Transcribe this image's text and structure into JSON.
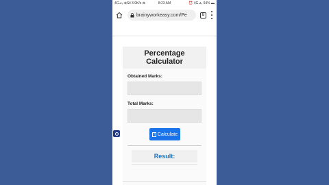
{
  "status_bar": {
    "left": "4G⊿ᵢₗ ⊗Sil 3.9K/s ⋒",
    "time": "8:23 AM",
    "right": "⏰ 4G⊿ᵢₗ 94% ▬"
  },
  "browser": {
    "url": "brainyworkeasy.com/Pe",
    "tab_count": "8"
  },
  "calculator": {
    "title_line1": "Percentage",
    "title_line2": "Calculator",
    "obtained_label": "Obtained Marks:",
    "obtained_value": "",
    "total_label": "Total Marks:",
    "total_value": "",
    "button_label": "Calculate",
    "result_label": "Result:"
  },
  "colors": {
    "background": "#3b5c96",
    "button": "#1a73e8",
    "result_text": "#1e73be"
  },
  "icons": {
    "home": "home-icon",
    "lock": "lock-icon",
    "tabs": "tabs-icon",
    "menu": "menu-icon",
    "calculator": "calculator-icon",
    "side_widget": "settings-widget-icon"
  }
}
